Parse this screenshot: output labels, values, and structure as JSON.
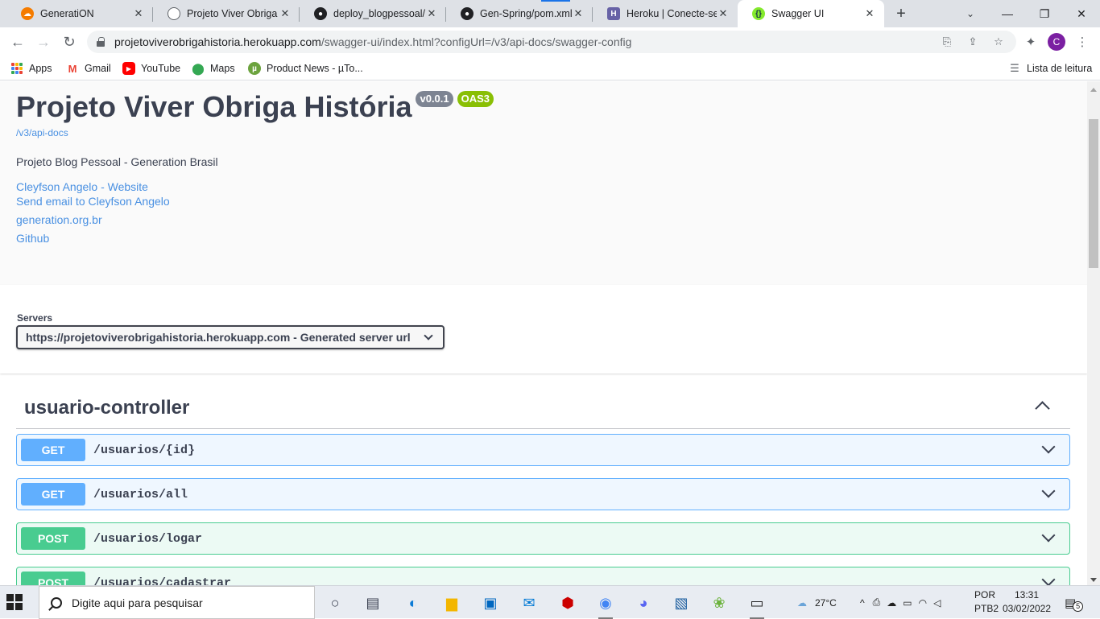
{
  "browser": {
    "tabs": [
      {
        "title": "GeneratiON",
        "active": false
      },
      {
        "title": "Projeto Viver Obriga H",
        "active": false
      },
      {
        "title": "deploy_blogpessoal/p",
        "active": false
      },
      {
        "title": "Gen-Spring/pom.xml",
        "active": false
      },
      {
        "title": "Heroku | Conecte-se",
        "active": false
      },
      {
        "title": "Swagger UI",
        "active": true
      }
    ],
    "new_tab_symbol": "+",
    "url_host": "projetoviverobrigahistoria.herokuapp.com",
    "url_path": "/swagger-ui/index.html?configUrl=/v3/api-docs/swagger-config",
    "profile_initial": "C",
    "bookmarks": [
      "Apps",
      "Gmail",
      "YouTube",
      "Maps",
      "Product News - µTo..."
    ],
    "reading_list": "Lista de leitura"
  },
  "swagger": {
    "title": "Projeto Viver Obriga História",
    "version_badge": "v0.0.1",
    "oas_badge": "OAS3",
    "api_docs_link": "/v3/api-docs",
    "description": "Projeto Blog Pessoal - Generation Brasil",
    "links": [
      "Cleyfson Angelo - Website",
      "Send email to Cleyfson Angelo",
      "generation.org.br",
      "Github"
    ],
    "servers_label": "Servers",
    "server_selected": "https://projetoviverobrigahistoria.herokuapp.com - Generated server url",
    "tag": "usuario-controller",
    "operations": [
      {
        "method": "GET",
        "path": "/usuarios/{id}"
      },
      {
        "method": "GET",
        "path": "/usuarios/all"
      },
      {
        "method": "POST",
        "path": "/usuarios/logar"
      },
      {
        "method": "POST",
        "path": "/usuarios/cadastrar"
      }
    ],
    "colors": {
      "get": "#61affe",
      "post": "#49cc90",
      "link": "#4990e2",
      "oas": "#89bf04"
    }
  },
  "taskbar": {
    "search_placeholder": "Digite aqui para pesquisar",
    "weather": "27°C",
    "lang_top": "POR",
    "lang_bottom": "PTB2",
    "time": "13:31",
    "date": "03/02/2022",
    "notification_count": "5"
  }
}
